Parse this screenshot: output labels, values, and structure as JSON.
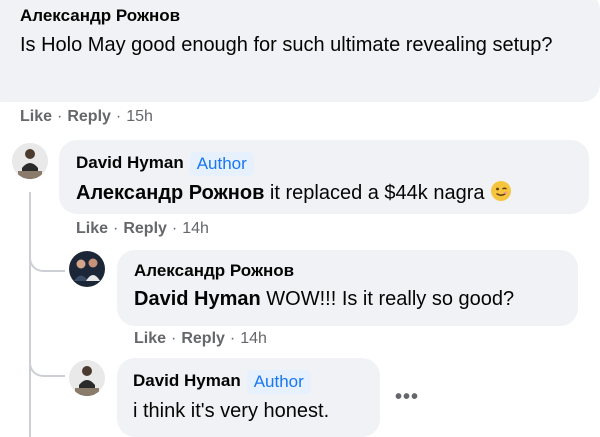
{
  "comments": [
    {
      "author": "Александр Рожнов",
      "text": "Is Holo May good enough for such ultimate revealing setup?",
      "like_label": "Like",
      "reply_label": "Reply",
      "time": "15h"
    },
    {
      "author": "David Hyman",
      "badge": "Author",
      "mention": "Александр Рожнов",
      "text": " it replaced a $44k nagra",
      "emoji": "winking-face",
      "like_label": "Like",
      "reply_label": "Reply",
      "time": "14h"
    },
    {
      "author": "Александр Рожнов",
      "mention": "David Hyman",
      "text": " WOW!!! Is it really so good?",
      "like_label": "Like",
      "reply_label": "Reply",
      "time": "14h"
    },
    {
      "author": "David Hyman",
      "badge": "Author",
      "text": "i think it's very honest.",
      "more_label": "•••"
    }
  ],
  "separator": "·",
  "colors": {
    "bubble": "#f0f2f5",
    "author_badge_bg": "#e7f0fd",
    "author_badge_text": "#1877f2",
    "meta": "#65676b",
    "thread_line": "#ccd0d5"
  }
}
